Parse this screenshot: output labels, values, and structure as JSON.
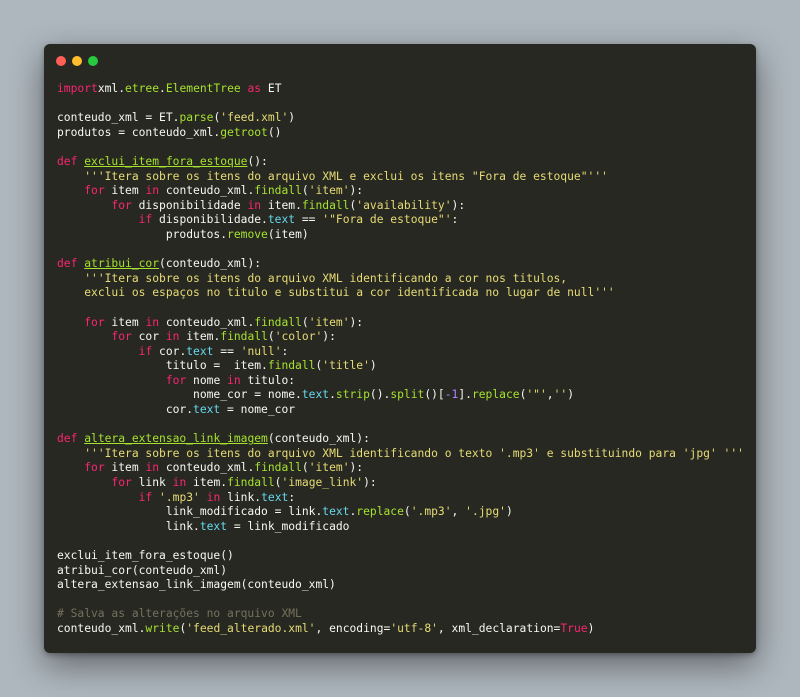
{
  "window": {
    "colors": {
      "background": "#272822",
      "page_background": "#aeb7be"
    },
    "traffic_lights": [
      {
        "name": "close-light",
        "color": "#ff5f56"
      },
      {
        "name": "minimize-light",
        "color": "#ffbd2e"
      },
      {
        "name": "maximize-light",
        "color": "#27c93f"
      }
    ]
  },
  "syntax_colors": {
    "keyword": "#f92672",
    "function": "#a6e22e",
    "string": "#e6db74",
    "builtin": "#66d9ef",
    "number": "#ae81ff",
    "comment": "#75715e",
    "default": "#f8f8f2"
  },
  "code": {
    "lines": [
      [
        [
          "kw",
          "import"
        ],
        [
          "",
          "xml."
        ],
        [
          "fn",
          "etree"
        ],
        [
          "",
          "."
        ],
        [
          "fn",
          "ElementTree"
        ],
        [
          "",
          " "
        ],
        [
          "kw",
          "as"
        ],
        [
          "",
          " ET"
        ]
      ],
      [],
      [
        [
          "",
          "conteudo_xml = ET."
        ],
        [
          "fn",
          "parse"
        ],
        [
          "",
          "("
        ],
        [
          "st",
          "'feed.xml'"
        ],
        [
          "",
          ")"
        ]
      ],
      [
        [
          "",
          "produtos = conteudo_xml."
        ],
        [
          "fn",
          "getroot"
        ],
        [
          "",
          "()"
        ]
      ],
      [],
      [
        [
          "kw",
          "def"
        ],
        [
          "",
          " "
        ],
        [
          "df",
          "exclui_item_fora_estoque"
        ],
        [
          "",
          "():"
        ]
      ],
      [
        [
          "",
          "    "
        ],
        [
          "st",
          "'''Itera sobre os itens do arquivo XML e exclui os itens \"Fora de estoque\"'''"
        ]
      ],
      [
        [
          "",
          "    "
        ],
        [
          "kw",
          "for"
        ],
        [
          "",
          " item "
        ],
        [
          "kw",
          "in"
        ],
        [
          "",
          " conteudo_xml."
        ],
        [
          "fn",
          "findall"
        ],
        [
          "",
          "("
        ],
        [
          "st",
          "'item'"
        ],
        [
          "",
          "):"
        ]
      ],
      [
        [
          "",
          "        "
        ],
        [
          "kw",
          "for"
        ],
        [
          "",
          " disponibilidade "
        ],
        [
          "kw",
          "in"
        ],
        [
          "",
          " item."
        ],
        [
          "fn",
          "findall"
        ],
        [
          "",
          "("
        ],
        [
          "st",
          "'availability'"
        ],
        [
          "",
          "):"
        ]
      ],
      [
        [
          "",
          "            "
        ],
        [
          "kw",
          "if"
        ],
        [
          "",
          " disponibilidade."
        ],
        [
          "bi",
          "text"
        ],
        [
          "",
          " == "
        ],
        [
          "st",
          "'\"Fora de estoque\"'"
        ],
        [
          "",
          ":"
        ]
      ],
      [
        [
          "",
          "                produtos."
        ],
        [
          "fn",
          "remove"
        ],
        [
          "",
          "(item)"
        ]
      ],
      [],
      [
        [
          "kw",
          "def"
        ],
        [
          "",
          " "
        ],
        [
          "df",
          "atribui_cor"
        ],
        [
          "",
          "(conteudo_xml):"
        ]
      ],
      [
        [
          "",
          "    "
        ],
        [
          "st",
          "'''Itera sobre os itens do arquivo XML identificando a cor nos titulos,"
        ]
      ],
      [
        [
          "",
          "    "
        ],
        [
          "st",
          "exclui os espaços no titulo e substitui a cor identificada no lugar de null'''"
        ]
      ],
      [],
      [
        [
          "",
          "    "
        ],
        [
          "kw",
          "for"
        ],
        [
          "",
          " item "
        ],
        [
          "kw",
          "in"
        ],
        [
          "",
          " conteudo_xml."
        ],
        [
          "fn",
          "findall"
        ],
        [
          "",
          "("
        ],
        [
          "st",
          "'item'"
        ],
        [
          "",
          "):"
        ]
      ],
      [
        [
          "",
          "        "
        ],
        [
          "kw",
          "for"
        ],
        [
          "",
          " cor "
        ],
        [
          "kw",
          "in"
        ],
        [
          "",
          " item."
        ],
        [
          "fn",
          "findall"
        ],
        [
          "",
          "("
        ],
        [
          "st",
          "'color'"
        ],
        [
          "",
          "):"
        ]
      ],
      [
        [
          "",
          "            "
        ],
        [
          "kw",
          "if"
        ],
        [
          "",
          " cor."
        ],
        [
          "bi",
          "text"
        ],
        [
          "",
          " == "
        ],
        [
          "st",
          "'null'"
        ],
        [
          "",
          ":"
        ]
      ],
      [
        [
          "",
          "                titulo =  item."
        ],
        [
          "fn",
          "findall"
        ],
        [
          "",
          "("
        ],
        [
          "st",
          "'title'"
        ],
        [
          "",
          ")"
        ]
      ],
      [
        [
          "",
          "                "
        ],
        [
          "kw",
          "for"
        ],
        [
          "",
          " nome "
        ],
        [
          "kw",
          "in"
        ],
        [
          "",
          " titulo:"
        ]
      ],
      [
        [
          "",
          "                    nome_cor = nome."
        ],
        [
          "bi",
          "text"
        ],
        [
          "",
          "."
        ],
        [
          "fn",
          "strip"
        ],
        [
          "",
          "()."
        ],
        [
          "fn",
          "split"
        ],
        [
          "",
          "()["
        ],
        [
          "nu",
          "-1"
        ],
        [
          "",
          "]."
        ],
        [
          "fn",
          "replace"
        ],
        [
          "",
          "("
        ],
        [
          "st",
          "'\"'"
        ],
        [
          "",
          ","
        ],
        [
          "st",
          "''"
        ],
        [
          "",
          ")"
        ]
      ],
      [
        [
          "",
          "                cor."
        ],
        [
          "bi",
          "text"
        ],
        [
          "",
          " = nome_cor"
        ]
      ],
      [],
      [
        [
          "kw",
          "def"
        ],
        [
          "",
          " "
        ],
        [
          "df",
          "altera_extensao_link_imagem"
        ],
        [
          "",
          "(conteudo_xml):"
        ]
      ],
      [
        [
          "",
          "    "
        ],
        [
          "st",
          "'''Itera sobre os itens do arquivo XML identificando o texto '.mp3' e substituindo para 'jpg' '''"
        ]
      ],
      [
        [
          "",
          "    "
        ],
        [
          "kw",
          "for"
        ],
        [
          "",
          " item "
        ],
        [
          "kw",
          "in"
        ],
        [
          "",
          " conteudo_xml."
        ],
        [
          "fn",
          "findall"
        ],
        [
          "",
          "("
        ],
        [
          "st",
          "'item'"
        ],
        [
          "",
          "):"
        ]
      ],
      [
        [
          "",
          "        "
        ],
        [
          "kw",
          "for"
        ],
        [
          "",
          " link "
        ],
        [
          "kw",
          "in"
        ],
        [
          "",
          " item."
        ],
        [
          "fn",
          "findall"
        ],
        [
          "",
          "("
        ],
        [
          "st",
          "'image_link'"
        ],
        [
          "",
          "):"
        ]
      ],
      [
        [
          "",
          "            "
        ],
        [
          "kw",
          "if"
        ],
        [
          "",
          " "
        ],
        [
          "st",
          "'.mp3'"
        ],
        [
          "",
          " "
        ],
        [
          "kw",
          "in"
        ],
        [
          "",
          " link."
        ],
        [
          "bi",
          "text"
        ],
        [
          "",
          ":"
        ]
      ],
      [
        [
          "",
          "                link_modificado = link."
        ],
        [
          "bi",
          "text"
        ],
        [
          "",
          "."
        ],
        [
          "fn",
          "replace"
        ],
        [
          "",
          "("
        ],
        [
          "st",
          "'.mp3'"
        ],
        [
          "",
          ", "
        ],
        [
          "st",
          "'.jpg'"
        ],
        [
          "",
          ")"
        ]
      ],
      [
        [
          "",
          "                link."
        ],
        [
          "bi",
          "text"
        ],
        [
          "",
          " = link_modificado"
        ]
      ],
      [],
      [
        [
          "",
          "exclui_item_fora_estoque()"
        ]
      ],
      [
        [
          "",
          "atribui_cor(conteudo_xml)"
        ]
      ],
      [
        [
          "",
          "altera_extensao_link_imagem(conteudo_xml)"
        ]
      ],
      [],
      [
        [
          "cm",
          "# Salva as alterações no arquivo XML"
        ]
      ],
      [
        [
          "",
          "conteudo_xml."
        ],
        [
          "fn",
          "write"
        ],
        [
          "",
          "("
        ],
        [
          "st",
          "'feed_alterado.xml'"
        ],
        [
          "",
          ", encoding="
        ],
        [
          "st",
          "'utf-8'"
        ],
        [
          "",
          ", xml_declaration="
        ],
        [
          "kw",
          "True"
        ],
        [
          "",
          ")"
        ]
      ]
    ]
  }
}
